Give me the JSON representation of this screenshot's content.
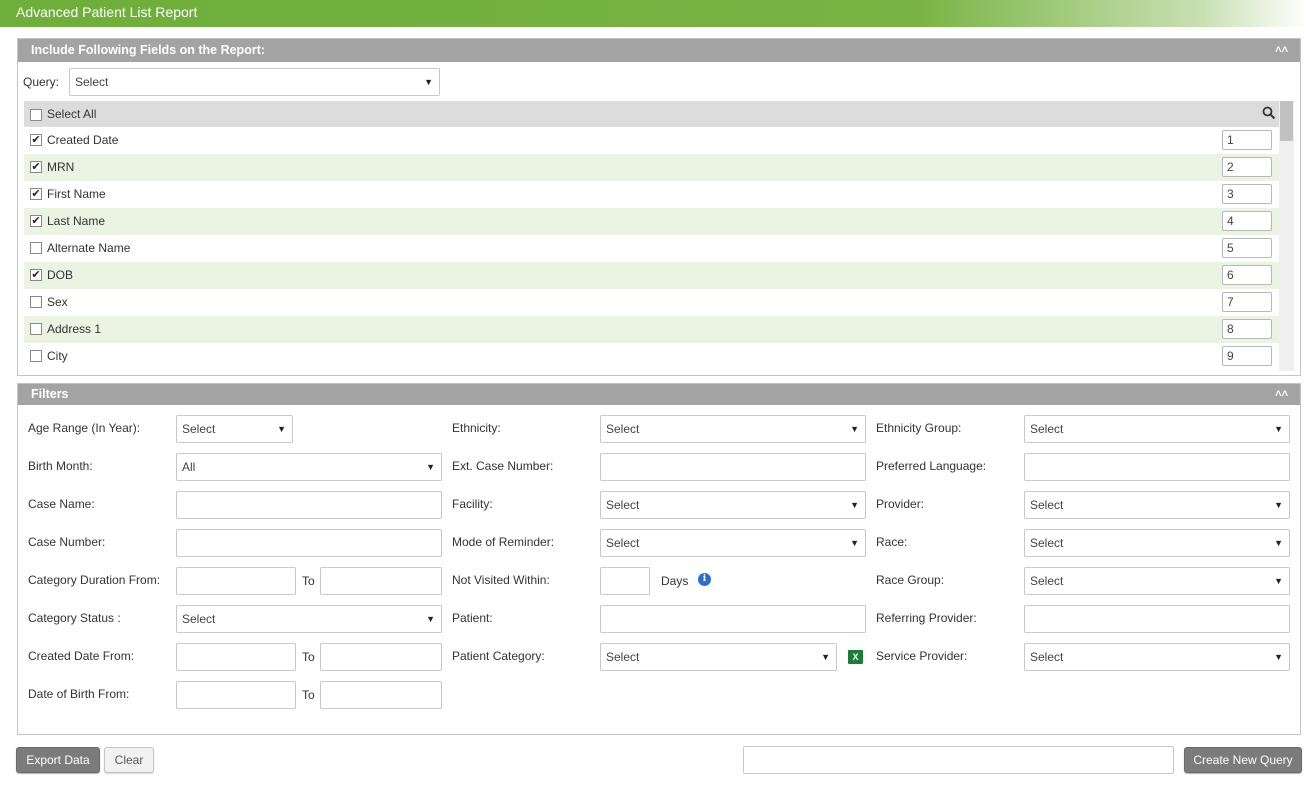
{
  "window": {
    "title": "Advanced Patient List Report"
  },
  "fields_panel": {
    "header": "Include Following Fields on the Report:",
    "collapse_icon": "chevron-double-up-icon",
    "query_label": "Query:",
    "query_value": "Select",
    "select_all_label": "Select All",
    "items": [
      {
        "label": "Created Date",
        "checked": true,
        "order": "1"
      },
      {
        "label": "MRN",
        "checked": true,
        "order": "2"
      },
      {
        "label": "First Name",
        "checked": true,
        "order": "3"
      },
      {
        "label": "Last Name",
        "checked": true,
        "order": "4"
      },
      {
        "label": "Alternate Name",
        "checked": false,
        "order": "5"
      },
      {
        "label": "DOB",
        "checked": true,
        "order": "6"
      },
      {
        "label": "Sex",
        "checked": false,
        "order": "7"
      },
      {
        "label": "Address 1",
        "checked": false,
        "order": "8"
      },
      {
        "label": "City",
        "checked": false,
        "order": "9"
      }
    ]
  },
  "filters": {
    "header": "Filters",
    "col1": {
      "age_range": {
        "label": "Age Range (In Year):",
        "value": "Select"
      },
      "birth_month": {
        "label": "Birth Month:",
        "value": "All"
      },
      "case_name": {
        "label": "Case Name:"
      },
      "case_number": {
        "label": "Case Number:"
      },
      "category_duration": {
        "label": "Category Duration From:",
        "to": "To"
      },
      "category_status": {
        "label": "Category Status :",
        "value": "Select"
      },
      "created_date": {
        "label": "Created Date From:",
        "to": "To"
      },
      "dob": {
        "label": "Date of Birth From:",
        "to": "To"
      }
    },
    "col2": {
      "ethnicity": {
        "label": "Ethnicity:",
        "value": "Select"
      },
      "ext_case_number": {
        "label": "Ext. Case Number:"
      },
      "facility": {
        "label": "Facility:",
        "value": "Select"
      },
      "mode_of_reminder": {
        "label": "Mode of Reminder:",
        "value": "Select"
      },
      "not_visited": {
        "label": "Not Visited Within:",
        "unit": "Days"
      },
      "patient": {
        "label": "Patient:"
      },
      "patient_category": {
        "label": "Patient Category:",
        "value": "Select"
      }
    },
    "col3": {
      "ethnicity_group": {
        "label": "Ethnicity Group:",
        "value": "Select"
      },
      "preferred_language": {
        "label": "Preferred Language:"
      },
      "provider": {
        "label": "Provider:",
        "value": "Select"
      },
      "race": {
        "label": "Race:",
        "value": "Select"
      },
      "race_group": {
        "label": "Race Group:",
        "value": "Select"
      },
      "referring_provider": {
        "label": "Referring Provider:"
      },
      "service_provider": {
        "label": "Service Provider:",
        "value": "Select"
      }
    }
  },
  "footer": {
    "export_label": "Export Data",
    "clear_label": "Clear",
    "create_query_label": "Create New Query"
  },
  "theme": {
    "accent": "#78b443",
    "panel_header": "#a3a3a3",
    "row_alt": "#ebf3e3"
  }
}
